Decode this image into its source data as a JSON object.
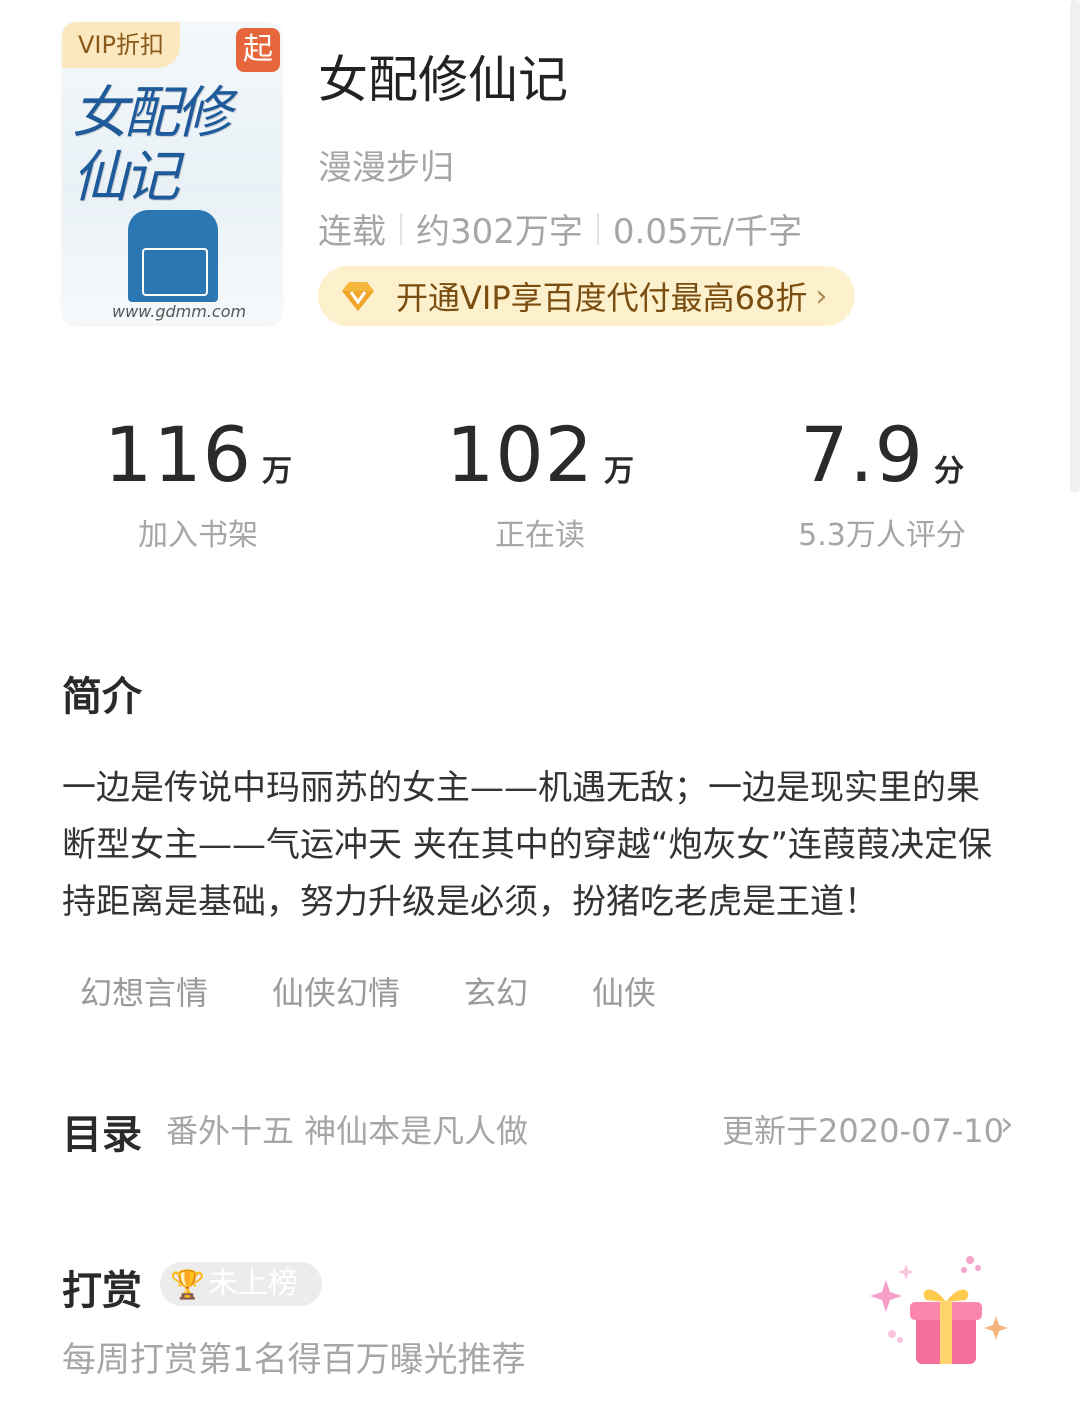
{
  "book": {
    "badge": "VIP折扣",
    "cover_logo": "起",
    "cover_title": "女配修仙记",
    "cover_url": "www.gdmm.com",
    "title": "女配修仙记",
    "author": "漫漫步归",
    "status": "连载",
    "word_count": "约302万字",
    "price": "0.05元/千字",
    "vip_promo": "开通VIP享百度代付最高68折",
    "vip_promo_icon": "vip-diamond-icon"
  },
  "stats": [
    {
      "value": "116",
      "unit": "万",
      "label": "加入书架"
    },
    {
      "value": "102",
      "unit": "万",
      "label": "正在读"
    },
    {
      "value": "7.9",
      "unit": "分",
      "label": "5.3万人评分"
    }
  ],
  "intro": {
    "title": "简介",
    "text": "一边是传说中玛丽苏的女主——机遇无敌；一边是现实里的果断型女主——气运冲天 夹在其中的穿越“炮灰女”连葭葭决定保持距离是基础，努力升级是必须，扮猪吃老虎是王道！",
    "tags": [
      "幻想言情",
      "仙侠幻情",
      "玄幻",
      "仙侠"
    ]
  },
  "catalog": {
    "title": "目录",
    "latest_chapter": "番外十五 神仙本是凡人做",
    "updated": "更新于2020-07-10"
  },
  "reward": {
    "title": "打赏",
    "rank_badge": "未上榜",
    "subtitle": "每周打赏第1名得百万曝光推荐"
  },
  "colors": {
    "vip_pill_bg": "#fdf0cc",
    "vip_text": "#7a4d10",
    "muted_text": "#a6a6a6"
  }
}
